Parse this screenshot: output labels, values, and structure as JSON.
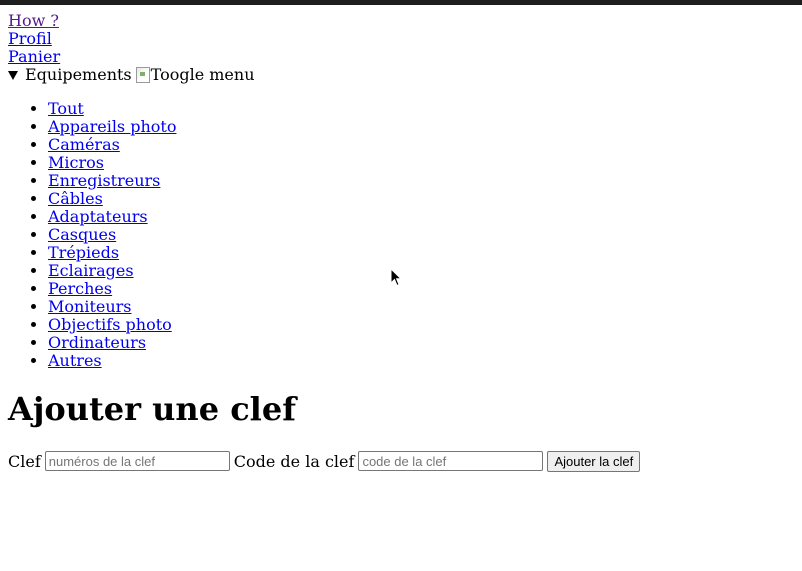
{
  "nav": {
    "links": [
      {
        "label": "How ?"
      },
      {
        "label": "Profil"
      },
      {
        "label": "Panier"
      }
    ]
  },
  "menu": {
    "summary_label": "Equipements",
    "toggle_image_alt": "Toogle menu",
    "items": [
      {
        "label": "Tout"
      },
      {
        "label": "Appareils photo"
      },
      {
        "label": "Caméras"
      },
      {
        "label": "Micros"
      },
      {
        "label": "Enregistreurs"
      },
      {
        "label": "Câbles"
      },
      {
        "label": "Adaptateurs"
      },
      {
        "label": "Casques"
      },
      {
        "label": "Trépieds"
      },
      {
        "label": "Eclairages"
      },
      {
        "label": "Perches"
      },
      {
        "label": "Moniteurs"
      },
      {
        "label": "Objectifs photo"
      },
      {
        "label": "Ordinateurs"
      },
      {
        "label": "Autres"
      }
    ]
  },
  "main": {
    "title": "Ajouter une clef",
    "form": {
      "key_label": "Clef",
      "key_placeholder": "numéros de la clef",
      "key_value": "",
      "code_label": "Code de la clef",
      "code_placeholder": "code de la clef",
      "code_value": "",
      "submit_label": "Ajouter la clef"
    }
  },
  "colors": {
    "link": "#0000ee",
    "visited_link": "#551a8b",
    "top_bar": "#1e1e1e"
  },
  "icons": {
    "menu_toggle": "triangle-down-icon",
    "broken_image": "broken-image-icon",
    "pointer": "mouse-cursor-icon"
  }
}
